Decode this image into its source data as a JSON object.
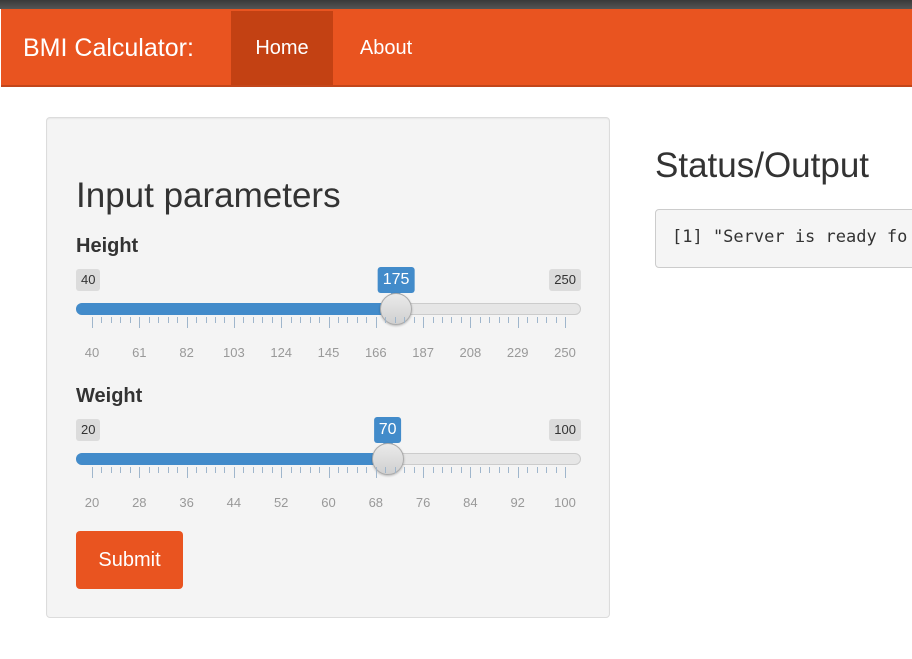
{
  "app": {
    "brand": "BMI Calculator:"
  },
  "nav": {
    "home_label": "Home",
    "about_label": "About",
    "active": "Home"
  },
  "input_panel": {
    "title": "Input parameters",
    "height": {
      "label": "Height",
      "min": 40,
      "max": 250,
      "value": 175,
      "min_text": "40",
      "max_text": "250",
      "value_text": "175",
      "tick_labels": [
        "40",
        "61",
        "82",
        "103",
        "124",
        "145",
        "166",
        "187",
        "208",
        "229",
        "250"
      ]
    },
    "weight": {
      "label": "Weight",
      "min": 20,
      "max": 100,
      "value": 70,
      "min_text": "20",
      "max_text": "100",
      "value_text": "70",
      "tick_labels": [
        "20",
        "28",
        "36",
        "44",
        "52",
        "60",
        "68",
        "76",
        "84",
        "92",
        "100"
      ]
    },
    "submit_label": "Submit"
  },
  "output": {
    "title": "Status/Output",
    "text": "[1] \"Server is ready fo"
  },
  "colors": {
    "accent": "#e95420",
    "active_nav": "#c34113",
    "slider": "#428bca"
  }
}
